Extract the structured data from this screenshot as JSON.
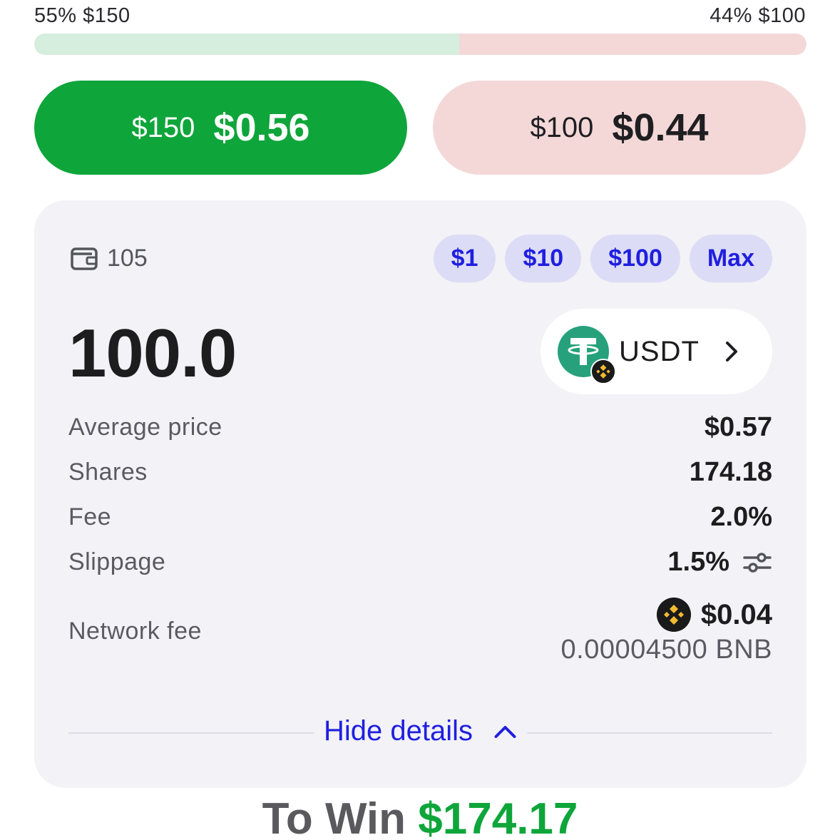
{
  "market": {
    "yes_label": "55% $150",
    "no_label": "44% $100",
    "yes_share": 0.55,
    "colors": {
      "yes": "#0ea53a",
      "yes_light": "#d5eedd",
      "no_light": "#f4d8d8"
    }
  },
  "outcomes": {
    "yes": {
      "label": "$150",
      "price": "$0.56"
    },
    "no": {
      "label": "$100",
      "price": "$0.44"
    }
  },
  "order": {
    "wallet_balance": "105",
    "wallet_icon": "wallet-icon",
    "quick_amounts": [
      "$1",
      "$10",
      "$100",
      "Max"
    ],
    "amount": "100.0",
    "token": {
      "symbol": "USDT",
      "icon": "tether-icon",
      "network_icon": "bnb-icon"
    }
  },
  "details": {
    "average_price": {
      "label": "Average price",
      "value": "$0.57"
    },
    "shares": {
      "label": "Shares",
      "value": "174.18"
    },
    "fee": {
      "label": "Fee",
      "value": "2.0%"
    },
    "slippage": {
      "label": "Slippage",
      "value": "1.5%"
    },
    "network_fee": {
      "label": "Network fee",
      "value": "$0.04",
      "native": "0.00004500 BNB"
    },
    "hide_label": "Hide details"
  },
  "summary": {
    "to_win_label": "To Win",
    "to_win_value": "$174.17"
  }
}
